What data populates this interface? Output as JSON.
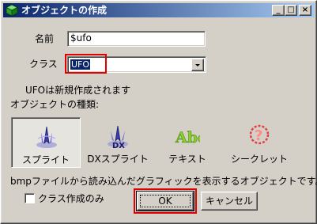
{
  "window": {
    "title": "オブジェクトの作成",
    "minimize": "_",
    "maximize": "□",
    "close": "×"
  },
  "form": {
    "name_label": "名前",
    "name_value": "$ufo",
    "class_label": "クラス",
    "class_value": "UFO",
    "class_note": "UFOは新規作成されます",
    "type_heading": "オブジェクトの種類:"
  },
  "object_types": [
    {
      "label": "スプライト",
      "icon": "sprite-icon",
      "selected": true
    },
    {
      "label": "DXスプライト",
      "icon": "dx-sprite-icon",
      "selected": false
    },
    {
      "label": "テキスト",
      "icon": "text-icon",
      "selected": false
    },
    {
      "label": "シークレット",
      "icon": "secret-icon",
      "selected": false
    }
  ],
  "description": "bmpファイルから読み込んだグラフィックを表示するオブジェクトです。",
  "class_only_checkbox": {
    "label": "クラス作成のみ",
    "checked": false
  },
  "buttons": {
    "ok": "OK",
    "cancel": "キャンセル"
  },
  "colors": {
    "titlebar_start": "#0a246a",
    "titlebar_end": "#a6caf0",
    "highlight_box": "#e00000",
    "selection": "#0a246a"
  }
}
